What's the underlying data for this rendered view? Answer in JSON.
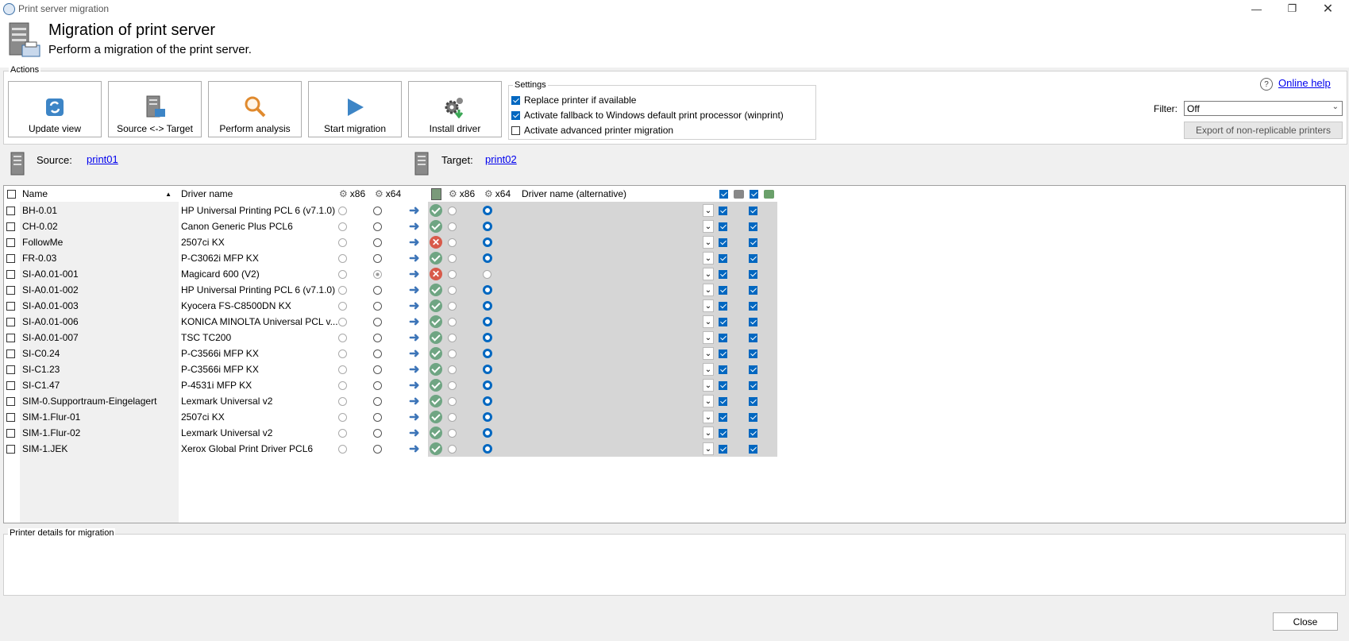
{
  "window": {
    "title": "Print server migration"
  },
  "header": {
    "title": "Migration of print server",
    "subtitle": "Perform a migration of the print server."
  },
  "actions": {
    "legend": "Actions",
    "buttons": [
      "Update view",
      "Source <-> Target",
      "Perform analysis",
      "Start migration",
      "Install driver"
    ]
  },
  "settings": {
    "legend": "Settings",
    "options": [
      {
        "label": "Replace printer if available",
        "checked": true
      },
      {
        "label": "Activate fallback to Windows default print processor (winprint)",
        "checked": true
      },
      {
        "label": "Activate advanced printer migration",
        "checked": false
      }
    ]
  },
  "help": {
    "label": "Online help"
  },
  "filter": {
    "label": "Filter:",
    "value": "Off"
  },
  "export_button": "Export of non-replicable printers",
  "source": {
    "label": "Source:",
    "value": "print01"
  },
  "target": {
    "label": "Target:",
    "value": "print02"
  },
  "table": {
    "columns": {
      "name": "Name",
      "driver": "Driver name",
      "x86": "x86",
      "x64": "x64",
      "x86b": "x86",
      "x64b": "x64",
      "alt": "Driver name (alternative)"
    },
    "rows": [
      {
        "name": "BH-0.01",
        "driver": "HP Universal Printing PCL 6 (v7.1.0)",
        "status": "ok"
      },
      {
        "name": "CH-0.02",
        "driver": "Canon Generic Plus PCL6",
        "status": "ok"
      },
      {
        "name": "FollowMe",
        "driver": "2507ci KX",
        "status": "error"
      },
      {
        "name": "FR-0.03",
        "driver": "P-C3062i MFP KX",
        "status": "ok"
      },
      {
        "name": "SI-A0.01-001",
        "driver": "Magicard 600 (V2)",
        "status": "error"
      },
      {
        "name": "SI-A0.01-002",
        "driver": "HP Universal Printing PCL 6 (v7.1.0)",
        "status": "ok"
      },
      {
        "name": "SI-A0.01-003",
        "driver": "Kyocera FS-C8500DN KX",
        "status": "ok"
      },
      {
        "name": "SI-A0.01-006",
        "driver": "KONICA MINOLTA Universal PCL v...",
        "status": "ok"
      },
      {
        "name": "SI-A0.01-007",
        "driver": "TSC TC200",
        "status": "ok"
      },
      {
        "name": "SI-C0.24",
        "driver": "P-C3566i MFP KX",
        "status": "ok"
      },
      {
        "name": "SI-C1.23",
        "driver": "P-C3566i MFP KX",
        "status": "ok"
      },
      {
        "name": "SI-C1.47",
        "driver": "P-4531i MFP KX",
        "status": "ok"
      },
      {
        "name": "SIM-0.Supportraum-Eingelagert",
        "driver": "Lexmark Universal v2",
        "status": "ok"
      },
      {
        "name": "SIM-1.Flur-01",
        "driver": "2507ci KX",
        "status": "ok"
      },
      {
        "name": "SIM-1.Flur-02",
        "driver": "Lexmark Universal v2",
        "status": "ok"
      },
      {
        "name": "SIM-1.JEK",
        "driver": "Xerox Global Print Driver PCL6",
        "status": "ok"
      }
    ]
  },
  "details": {
    "legend": "Printer details for migration"
  },
  "close_button": "Close"
}
